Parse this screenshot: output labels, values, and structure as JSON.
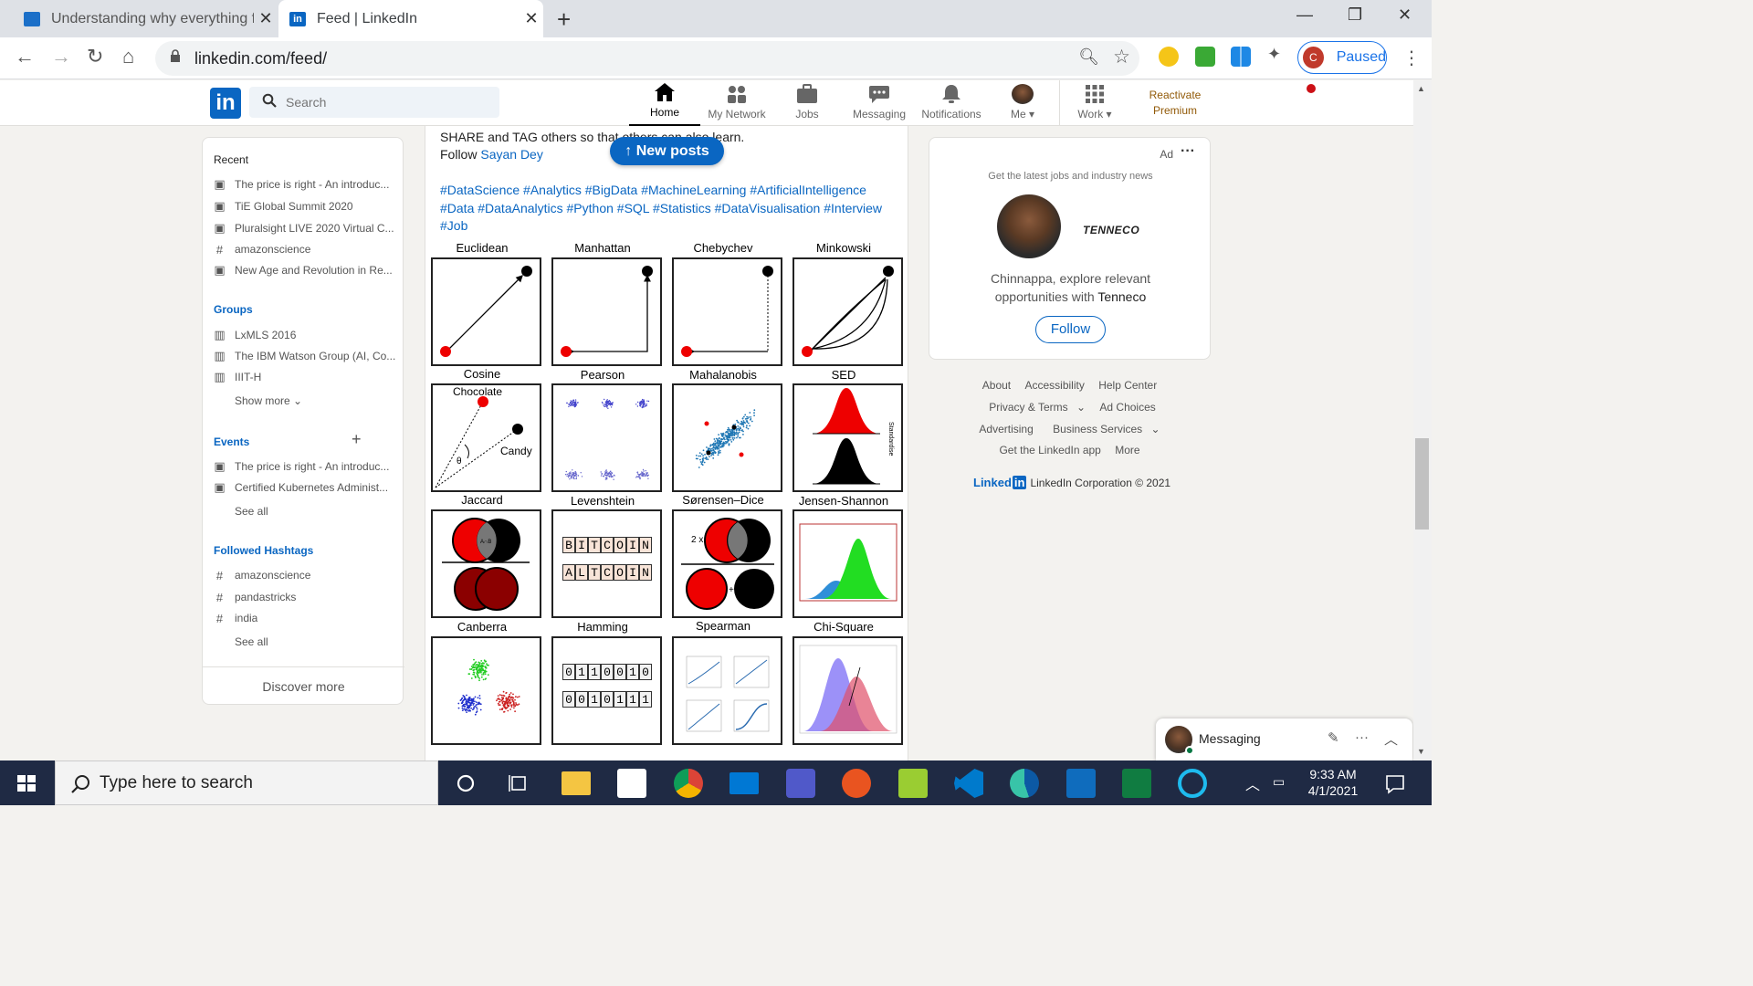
{
  "browser": {
    "tabs": [
      {
        "title": "Understanding why everything fe",
        "active": false
      },
      {
        "title": "Feed | LinkedIn",
        "active": true
      }
    ],
    "url": "linkedin.com/feed/",
    "profile_initial": "C",
    "profile_status": "Paused"
  },
  "header": {
    "logo": "in",
    "search_placeholder": "Search",
    "nav": [
      {
        "label": "Home",
        "active": true
      },
      {
        "label": "My Network"
      },
      {
        "label": "Jobs"
      },
      {
        "label": "Messaging"
      },
      {
        "label": "Notifications"
      },
      {
        "label": "Me"
      },
      {
        "label": "Work"
      }
    ],
    "premium": "Reactivate Premium"
  },
  "left": {
    "recent_title": "Recent",
    "recent": [
      {
        "icon": "calendar",
        "text": "The price is right - An introduc..."
      },
      {
        "icon": "calendar",
        "text": "TiE Global Summit 2020"
      },
      {
        "icon": "calendar",
        "text": "Pluralsight LIVE 2020 Virtual C..."
      },
      {
        "icon": "hashtag",
        "text": "amazonscience"
      },
      {
        "icon": "calendar",
        "text": "New Age and Revolution in Re..."
      }
    ],
    "groups_title": "Groups",
    "groups": [
      "LxMLS 2016",
      "The IBM Watson Group (AI, Co...",
      "IIIT-H"
    ],
    "show_more": "Show more",
    "events_title": "Events",
    "events": [
      "The price is right - An introduc...",
      "Certified Kubernetes Administ..."
    ],
    "see_all": "See all",
    "hashtags_title": "Followed Hashtags",
    "hashtags": [
      "amazonscience",
      "pandastricks",
      "india"
    ],
    "see_all_2": "See all",
    "discover": "Discover more"
  },
  "post": {
    "line1": "SHARE and TAG others so that others can also learn.",
    "follow_prefix": "Follow ",
    "follow_name": "Sayan Dey",
    "hashtags": "#DataScience #Analytics #BigData #MachineLearning #ArtificialIntelligence #Data #DataAnalytics #Python #SQL #Statistics #DataVisualisation #Interview #Job",
    "new_posts": "New posts",
    "panels": [
      "Euclidean",
      "Manhattan",
      "Chebychev",
      "Minkowski",
      "Cosine",
      "Pearson",
      "Mahalanobis",
      "SED",
      "Jaccard",
      "Levenshtein",
      "Sørensen–Dice",
      "Jensen-Shannon",
      "Canberra",
      "Hamming",
      "Spearman",
      "Chi-Square"
    ],
    "cosine_labels": {
      "a": "Chocolate",
      "b": "Candy",
      "theta": "θ"
    },
    "levenshtein": {
      "w1": [
        "B",
        "I",
        "T",
        "C",
        "O",
        "I",
        "N"
      ],
      "w2": [
        "A",
        "L",
        "T",
        "C",
        "O",
        "I",
        "N"
      ]
    },
    "hamming": {
      "w1": [
        "0",
        "1",
        "1",
        "0",
        "0",
        "1",
        "0"
      ],
      "w2": [
        "0",
        "0",
        "1",
        "0",
        "1",
        "1",
        "1"
      ]
    },
    "jaccard_center": "A∩B",
    "dice_prefix": "2 x",
    "sed_axis": "Standardise"
  },
  "ad": {
    "label": "Ad",
    "subtitle": "Get the latest jobs and industry news",
    "company_logo": "TENNECO",
    "text_prefix": "Chinnappa, explore relevant opportunities with ",
    "company": "Tenneco",
    "follow": "Follow"
  },
  "footer": {
    "row1": [
      "About",
      "Accessibility",
      "Help Center"
    ],
    "row2": [
      "Privacy & Terms",
      "Ad Choices"
    ],
    "row3": [
      "Advertising",
      "Business Services"
    ],
    "row4": [
      "Get the LinkedIn app",
      "More"
    ],
    "brand": "Linked",
    "copyright": "LinkedIn Corporation © 2021"
  },
  "messaging": {
    "label": "Messaging"
  },
  "taskbar": {
    "search_placeholder": "Type here to search",
    "time": "9:33 AM",
    "date": "4/1/2021"
  },
  "colors": {
    "linkedin_blue": "#0a66c2",
    "taskbar": "#1f2a44"
  }
}
